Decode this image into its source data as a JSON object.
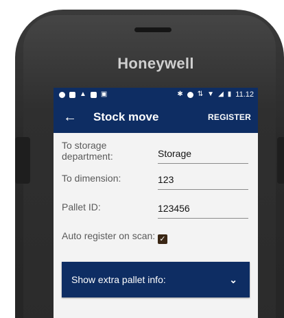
{
  "device": {
    "brand": "Honeywell"
  },
  "status_bar": {
    "left_icons": [
      "circle-icon",
      "image-icon",
      "android-icon",
      "square-icon",
      "robot-icon"
    ],
    "right_icons": [
      "bluetooth-icon",
      "do-not-disturb-icon",
      "data-arrows-icon",
      "wifi-icon",
      "no-signal-icon",
      "battery-icon"
    ],
    "time": "11.12"
  },
  "app_bar": {
    "title": "Stock move",
    "action_label": "REGISTER"
  },
  "form": {
    "storage": {
      "label": "To storage department:",
      "value": "Storage"
    },
    "dimension": {
      "label": "To dimension:",
      "value": "123"
    },
    "pallet": {
      "label": "Pallet ID:",
      "value": "123456"
    },
    "auto_register": {
      "label": "Auto register on scan:",
      "checked": true
    }
  },
  "expander": {
    "label": "Show extra pallet info:"
  },
  "colors": {
    "primary": "#0e2d63",
    "checkbox": "#3a2614",
    "background": "#f3f3f3"
  }
}
